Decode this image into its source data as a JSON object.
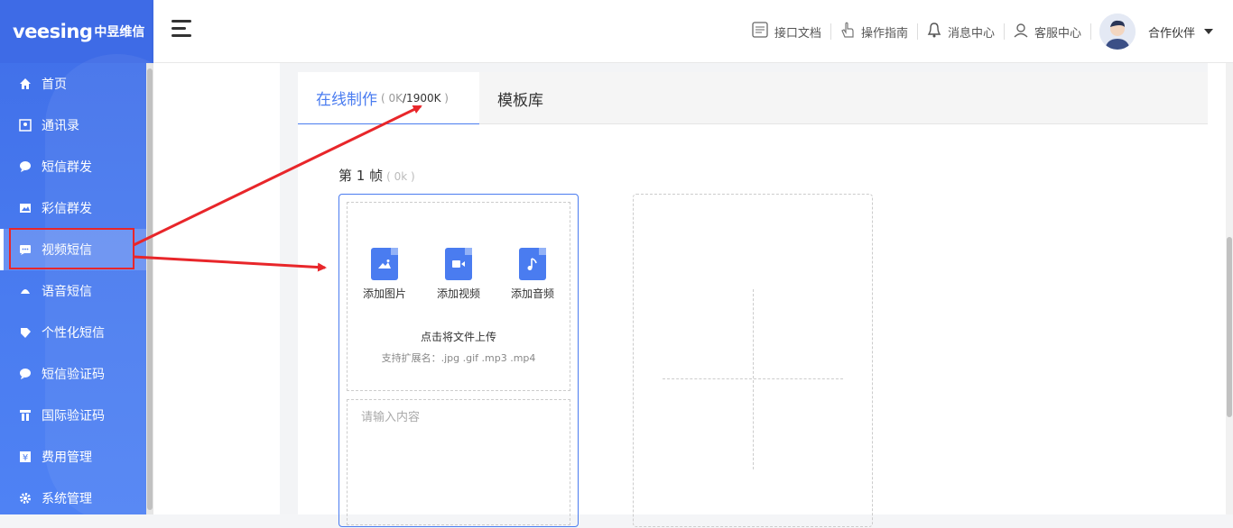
{
  "brand": {
    "logo_text": "veesing",
    "logo_cn": "中昱维信"
  },
  "sidebar": {
    "items": [
      {
        "label": "首页",
        "icon": "home-icon"
      },
      {
        "label": "通讯录",
        "icon": "contacts-icon"
      },
      {
        "label": "短信群发",
        "icon": "sms-icon"
      },
      {
        "label": "彩信群发",
        "icon": "mms-icon"
      },
      {
        "label": "视频短信",
        "icon": "video-sms-icon"
      },
      {
        "label": "语音短信",
        "icon": "voice-sms-icon"
      },
      {
        "label": "个性化短信",
        "icon": "personalized-sms-icon"
      },
      {
        "label": "短信验证码",
        "icon": "sms-code-icon"
      },
      {
        "label": "国际验证码",
        "icon": "intl-code-icon"
      },
      {
        "label": "费用管理",
        "icon": "yen-icon"
      },
      {
        "label": "系统管理",
        "icon": "gear-icon"
      }
    ],
    "active_index": 4
  },
  "header": {
    "links": [
      {
        "label": "接口文档",
        "icon": "doc-icon"
      },
      {
        "label": "操作指南",
        "icon": "hand-icon"
      },
      {
        "label": "消息中心",
        "icon": "bell-icon"
      },
      {
        "label": "客服中心",
        "icon": "support-icon"
      }
    ],
    "user_name": "合作伙伴"
  },
  "tabs": {
    "online": {
      "label": "在线制作",
      "count_used": "0K",
      "count_total": "/1900K"
    },
    "templates": {
      "label": "模板库"
    }
  },
  "frame": {
    "title": "第 1 帧",
    "size": "( 0k )",
    "add_image": "添加图片",
    "add_video": "添加视频",
    "add_audio": "添加音频",
    "upload_hint": "点击将文件上传",
    "upload_ext": "支持扩展名：.jpg .gif .mp3 .mp4",
    "text_placeholder": "请输入内容"
  },
  "colors": {
    "accent": "#4a7cf0",
    "sidebar": "#4a7cf0",
    "annotation": "#e8262a"
  }
}
